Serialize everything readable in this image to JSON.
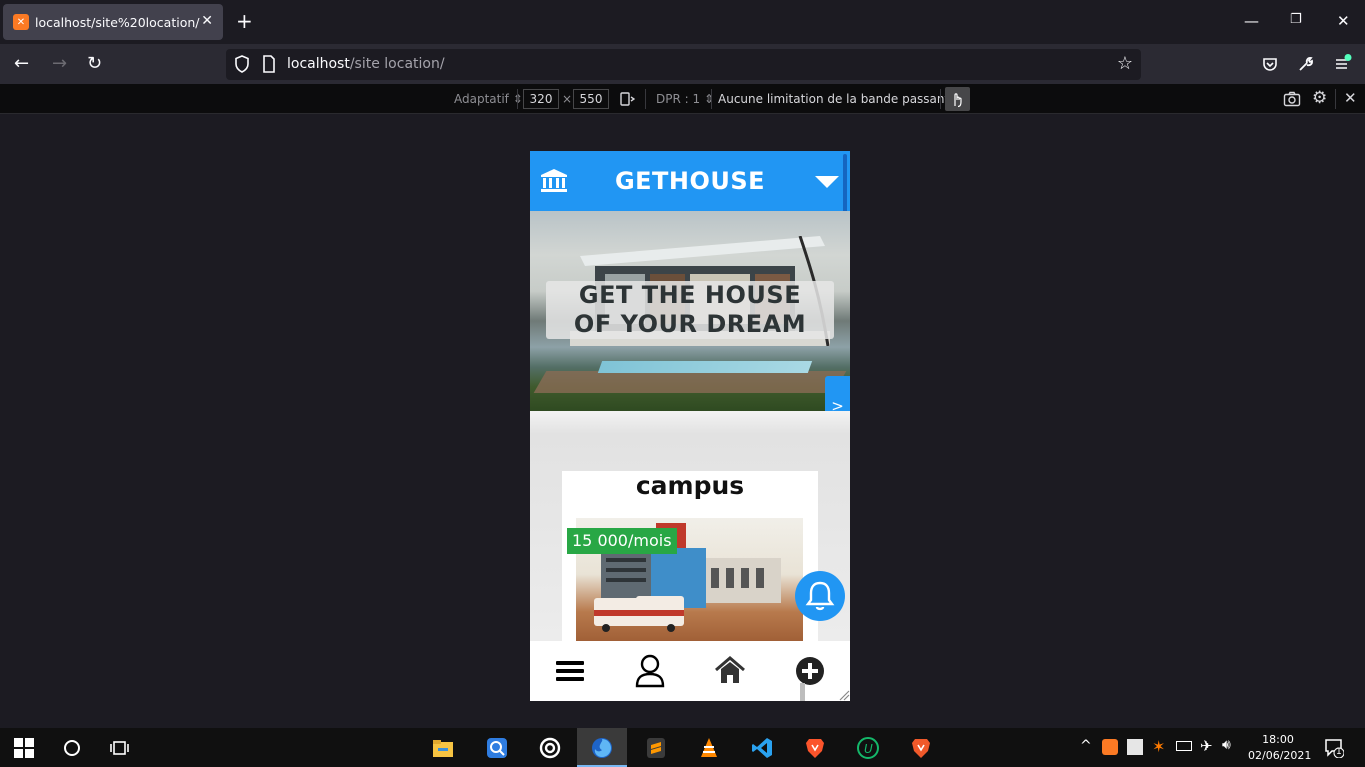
{
  "browser": {
    "tab_title": "localhost/site%20location/",
    "url_host": "localhost",
    "url_path": "/site location/"
  },
  "rdm": {
    "preset": "Adaptatif",
    "width": "320",
    "times": "×",
    "height": "550",
    "dpr": "DPR : 1",
    "throttling": "Aucune limitation de la bande passante"
  },
  "app": {
    "brand": "GETHOUSE",
    "hero_line1": "GET THE HOUSE",
    "hero_line2": "OF YOUR DREAM",
    "next_label": ">",
    "card_title": "campus",
    "price": "15 000/mois",
    "colors": {
      "primary": "#2196f3",
      "price": "#28a745"
    },
    "bottom_nav": [
      "menu-icon",
      "user-icon",
      "home-icon",
      "add-icon"
    ]
  },
  "taskbar": {
    "time": "18:00",
    "date": "02/06/2021",
    "notification_count": "1"
  }
}
